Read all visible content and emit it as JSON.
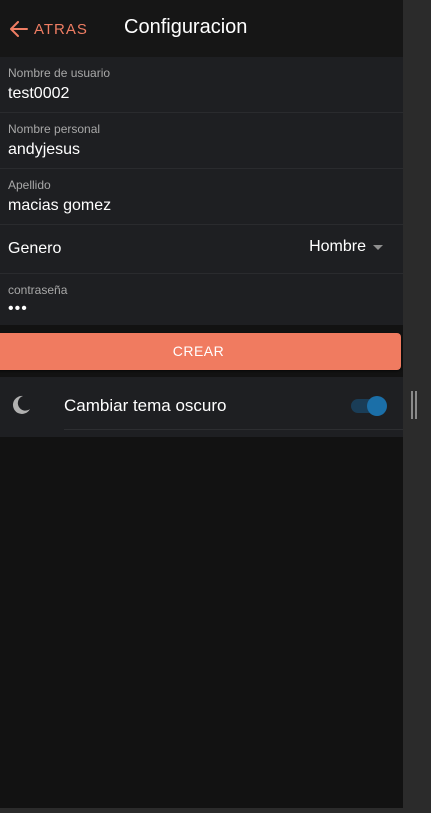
{
  "header": {
    "back_label": "ATRAS",
    "title": "Configuracion"
  },
  "form": {
    "username": {
      "label": "Nombre de usuario",
      "value": "test0002"
    },
    "name": {
      "label": "Nombre personal",
      "value": "andyjesus"
    },
    "surname": {
      "label": "Apellido",
      "value": "macias gomez"
    },
    "gender": {
      "label": "Genero",
      "value": "Hombre"
    },
    "password": {
      "label": "contraseña",
      "value": "•••"
    }
  },
  "create_button": {
    "label": "CREAR"
  },
  "theme": {
    "label": "Cambiar tema oscuro",
    "enabled": true
  },
  "icons": {
    "back": "arrow-left-icon",
    "select": "caret-down-icon",
    "theme": "moon-icon",
    "splitter": "drag-handle-icon"
  },
  "colors": {
    "accent": "#f07b60",
    "background": "#121212",
    "surface": "#1e1f22",
    "toggle_on": "#1b6fa8"
  }
}
